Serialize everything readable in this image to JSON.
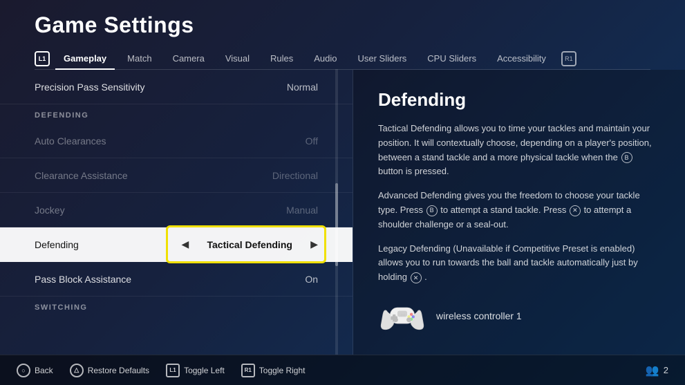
{
  "page": {
    "title": "Game Settings",
    "background_color": "#1a1a2e"
  },
  "nav": {
    "active_badge": "L1",
    "tabs": [
      {
        "id": "gameplay",
        "label": "Gameplay",
        "active": true
      },
      {
        "id": "match",
        "label": "Match",
        "active": false
      },
      {
        "id": "camera",
        "label": "Camera",
        "active": false
      },
      {
        "id": "visual",
        "label": "Visual",
        "active": false
      },
      {
        "id": "rules",
        "label": "Rules",
        "active": false
      },
      {
        "id": "audio",
        "label": "Audio",
        "active": false
      },
      {
        "id": "user-sliders",
        "label": "User Sliders",
        "active": false
      },
      {
        "id": "cpu-sliders",
        "label": "CPU Sliders",
        "active": false
      },
      {
        "id": "accessibility",
        "label": "Accessibility",
        "active": false
      }
    ],
    "right_badge": "R1"
  },
  "settings": {
    "rows": [
      {
        "id": "precision-pass",
        "name": "Precision Pass Sensitivity",
        "value": "Normal",
        "section": null,
        "dimmed": false,
        "active": false
      },
      {
        "id": "defending-section",
        "name": "DEFENDING",
        "value": null,
        "section": true,
        "dimmed": false,
        "active": false
      },
      {
        "id": "auto-clearances",
        "name": "Auto Clearances",
        "value": "Off",
        "section": null,
        "dimmed": true,
        "active": false
      },
      {
        "id": "clearance-assistance",
        "name": "Clearance Assistance",
        "value": "Directional",
        "section": null,
        "dimmed": true,
        "active": false
      },
      {
        "id": "jockey",
        "name": "Jockey",
        "value": "Manual",
        "section": null,
        "dimmed": true,
        "active": false
      },
      {
        "id": "defending",
        "name": "Defending",
        "value": "Tactical Defending",
        "section": null,
        "dimmed": false,
        "active": true
      },
      {
        "id": "pass-block",
        "name": "Pass Block Assistance",
        "value": "On",
        "section": null,
        "dimmed": false,
        "active": false
      },
      {
        "id": "switching-section",
        "name": "SWITCHING",
        "value": null,
        "section": true,
        "dimmed": false,
        "active": false
      }
    ]
  },
  "detail_panel": {
    "title": "Defending",
    "paragraphs": [
      "Tactical Defending allows you to time your tackles and maintain your position. It will contextually choose, depending on a player's position, between a stand tackle and a more physical tackle when the ⓑ button is pressed.",
      "Advanced Defending gives you the freedom to choose your tackle type. Press ⓑ to attempt a stand tackle. Press ✕ to attempt a shoulder challenge or a seal-out.",
      "Legacy Defending (Unavailable if Competitive Preset is enabled) allows you to run towards the ball and tackle automatically just by holding ✕ ."
    ],
    "controller": {
      "name": "wireless controller 1"
    }
  },
  "bottom_bar": {
    "actions": [
      {
        "id": "back",
        "button": "○",
        "label": "Back",
        "button_type": "circle"
      },
      {
        "id": "restore",
        "button": "△",
        "label": "Restore Defaults",
        "button_type": "circle"
      },
      {
        "id": "toggle-left",
        "button": "L1",
        "label": "Toggle Left",
        "button_type": "square"
      },
      {
        "id": "toggle-right",
        "button": "R1",
        "label": "Toggle Right",
        "button_type": "square"
      }
    ],
    "users_count": "2"
  }
}
